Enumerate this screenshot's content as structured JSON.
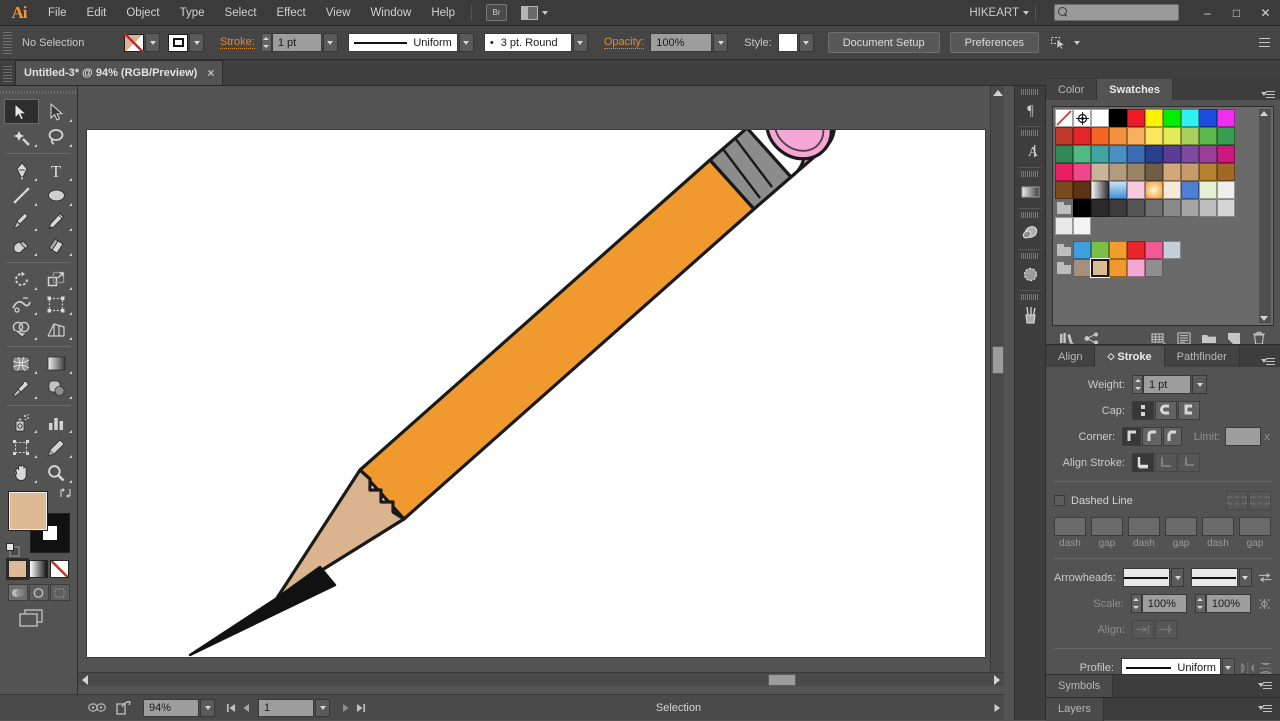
{
  "app": {
    "logo": "Ai",
    "menus": [
      "File",
      "Edit",
      "Object",
      "Type",
      "Select",
      "Effect",
      "View",
      "Window",
      "Help"
    ],
    "bridge_label": "Br",
    "workspace": "HIKEART",
    "search_placeholder": "",
    "window_controls": {
      "minimize": "–",
      "maximize": "□",
      "close": "✕"
    }
  },
  "control_bar": {
    "selection_state": "No Selection",
    "stroke_label": "Stroke:",
    "stroke_weight": "1 pt",
    "stroke_profile": "Uniform",
    "brush_definition": "3 pt. Round",
    "opacity_label": "Opacity:",
    "opacity_value": "100%",
    "style_label": "Style:",
    "document_setup": "Document Setup",
    "preferences": "Preferences"
  },
  "document": {
    "tab_title": "Untitled-3* @ 94% (RGB/Preview)",
    "close_glyph": "×"
  },
  "tools": {
    "items": [
      {
        "name": "selection-tool",
        "active": true
      },
      {
        "name": "direct-selection-tool",
        "active": false
      },
      {
        "name": "magic-wand-tool",
        "active": false
      },
      {
        "name": "lasso-tool",
        "active": false
      },
      {
        "name": "pen-tool",
        "active": false
      },
      {
        "name": "type-tool",
        "active": false
      },
      {
        "name": "line-segment-tool",
        "active": false
      },
      {
        "name": "ellipse-tool",
        "active": false
      },
      {
        "name": "paintbrush-tool",
        "active": false
      },
      {
        "name": "pencil-tool",
        "active": false
      },
      {
        "name": "blob-brush-tool",
        "active": false
      },
      {
        "name": "eraser-tool",
        "active": false
      },
      {
        "name": "rotate-tool",
        "active": false
      },
      {
        "name": "scale-tool",
        "active": false
      },
      {
        "name": "width-tool",
        "active": false
      },
      {
        "name": "free-transform-tool",
        "active": false
      },
      {
        "name": "shape-builder-tool",
        "active": false
      },
      {
        "name": "perspective-grid-tool",
        "active": false
      },
      {
        "name": "mesh-tool",
        "active": false
      },
      {
        "name": "gradient-tool",
        "active": false
      },
      {
        "name": "eyedropper-tool",
        "active": false
      },
      {
        "name": "blend-tool",
        "active": false
      },
      {
        "name": "symbol-sprayer-tool",
        "active": false
      },
      {
        "name": "column-graph-tool",
        "active": false
      },
      {
        "name": "artboard-tool",
        "active": false
      },
      {
        "name": "slice-tool",
        "active": false
      },
      {
        "name": "hand-tool",
        "active": false
      },
      {
        "name": "zoom-tool",
        "active": false
      }
    ],
    "fill_color": "#ddba94",
    "stroke_color": "#111111"
  },
  "swatches_panel": {
    "tabs": [
      {
        "label": "Color",
        "active": false
      },
      {
        "label": "Swatches",
        "active": true
      }
    ],
    "rows": [
      [
        "none",
        "registration",
        "#ffffff",
        "#000000",
        "#ed1c24",
        "#fff200",
        "#00ff00",
        "#00ffff",
        "#0000ff",
        "#ff00ff"
      ],
      [
        "#c0392b",
        "#e3262a",
        "#f26522",
        "#f3913d",
        "#f7b05b",
        "#fff45e",
        "#e5ea5a",
        "#a8d05a",
        "#5bb94e",
        "#3a9e52"
      ],
      [
        "#2e8b57",
        "#4fba82",
        "#3fa5a5",
        "#4a90c4",
        "#3b6cb5",
        "#2b3f8f",
        "#5b3d96",
        "#7e4aa0",
        "#9b3f96",
        "#c8197c"
      ],
      [
        "#e91e63",
        "#f0468c",
        "#cbb39a",
        "#b39b80",
        "#9a8265",
        "#6f5d44",
        "#d2a877",
        "#c79a6a",
        "#b5822f",
        "#a06a24"
      ],
      [
        "#7a4a1d",
        "#5d3314",
        "grad-white-black",
        "grad-blue",
        "dots-pink",
        "radial-orange",
        "dots-beige",
        "pattern-blue",
        "pattern-green",
        "#eeeeee"
      ],
      [
        "folder",
        "#000000",
        "#2a2a2a",
        "#3b3b3b",
        "#555555",
        "#6f6f6f",
        "#8a8a8a",
        "#a5a5a5",
        "#bdbdbd",
        "#d5d5d5"
      ],
      [
        "#e8e8e8",
        "#f4f4f4"
      ],
      [
        "folder",
        "#3fa0e0",
        "#7bc043",
        "#f39c2b",
        "#e8262b",
        "#f25a96",
        "#c3d0da"
      ],
      [
        "folder",
        "#a3907c",
        "#ddba94",
        "#f0992e",
        "#f4a6d4",
        "#8f8f8f"
      ]
    ],
    "selected_swatch": "#ddba94",
    "footer_icons": [
      "swatch-libraries-icon",
      "color-group-icon",
      "show-swatch-kinds-icon",
      "swatch-options-icon",
      "new-color-group-icon",
      "new-swatch-icon",
      "delete-swatch-icon"
    ]
  },
  "stroke_panel": {
    "tabs": [
      {
        "label": "Align",
        "active": false
      },
      {
        "label": "Stroke",
        "active": true
      },
      {
        "label": "Pathfinder",
        "active": false
      }
    ],
    "weight_label": "Weight:",
    "weight_value": "1 pt",
    "cap_label": "Cap:",
    "corner_label": "Corner:",
    "limit_label": "Limit:",
    "limit_value": "",
    "limit_unit": "x",
    "align_stroke_label": "Align Stroke:",
    "dashed_line_label": "Dashed Line",
    "dashed_line_checked": false,
    "dash_fields": [
      {
        "label": "dash",
        "value": ""
      },
      {
        "label": "gap",
        "value": ""
      },
      {
        "label": "dash",
        "value": ""
      },
      {
        "label": "gap",
        "value": ""
      },
      {
        "label": "dash",
        "value": ""
      },
      {
        "label": "gap",
        "value": ""
      }
    ],
    "arrowheads_label": "Arrowheads:",
    "scale_label": "Scale:",
    "scale_start": "100%",
    "scale_end": "100%",
    "align_label": "Align:",
    "profile_label": "Profile:",
    "profile_value": "Uniform"
  },
  "collapsed_panels": [
    {
      "label": "Symbols"
    },
    {
      "label": "Layers"
    }
  ],
  "icon_dock": [
    "paragraph-icon",
    "character-icon",
    "gradient-icon",
    "appearance-icon",
    "transparency-icon",
    "brushes-icon"
  ],
  "status_bar": {
    "zoom_level": "94%",
    "page_number": "1",
    "status_text": "Selection"
  },
  "artwork": {
    "name": "pencil-illustration",
    "colors": {
      "body": "#f0992e",
      "eraser": "#f4a6d4",
      "ferrule": "#8c8c8c",
      "wood": "#d9b48f",
      "graphite": "#111111",
      "outline": "#1a1a1a"
    }
  }
}
